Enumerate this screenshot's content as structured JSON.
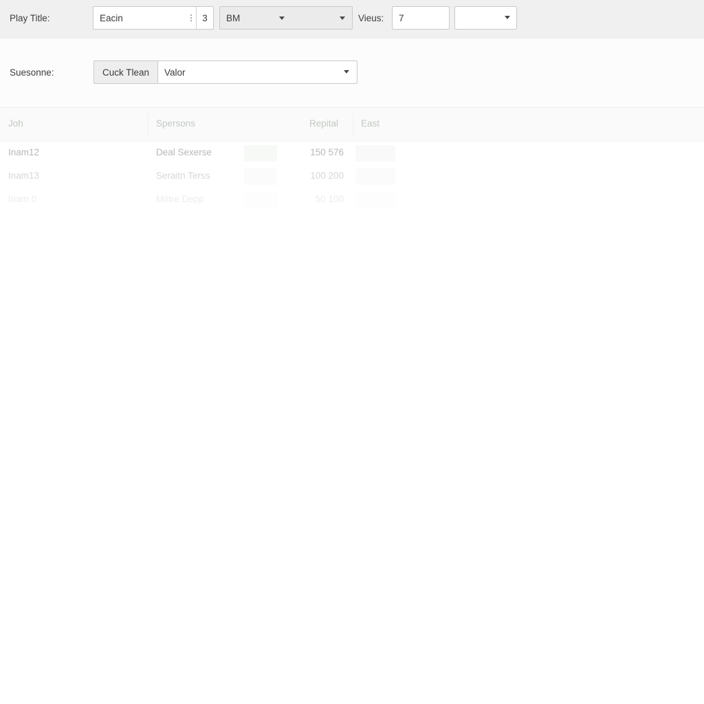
{
  "toolbar": {
    "play_title_label": "Play Title:",
    "title_input_value": "Eacin",
    "title_count_value": "3",
    "type_select_value": "BM",
    "views_label": "Vieus:",
    "views_input_value": "7",
    "views_select_value": "",
    "dots_icon": "vertical-dots-icon",
    "caret_icon": "chevron-down-icon"
  },
  "filters": {
    "season_label": "Suesonne:",
    "clear_button_label": "Cuck Tlean",
    "season_select_value": "Valor"
  },
  "table": {
    "columns": [
      "Joh",
      "Spersons",
      "Repital",
      "East"
    ],
    "rows": [
      {
        "job": "Inam12",
        "persons": "Deal Sexerse",
        "status_chip": "",
        "capital": "150 576",
        "east_chip": ""
      },
      {
        "job": "Inam13",
        "persons": "Seraitn Terss",
        "status_chip": "",
        "capital": "100 200",
        "east_chip": ""
      },
      {
        "job": "Inam 0",
        "persons": "Mittre Depp",
        "status_chip": "",
        "capital": "50 100",
        "east_chip": ""
      }
    ]
  },
  "colors": {
    "toolbar_bg": "#f0f0f0",
    "second_band_bg": "#fcfcfc",
    "header_bg": "#fafafa",
    "chip_green": "#e8efe8",
    "chip_grey": "#ededed",
    "border": "#c9c9c9",
    "text": "#3a3a3a",
    "muted_text": "#c3c9c3"
  }
}
